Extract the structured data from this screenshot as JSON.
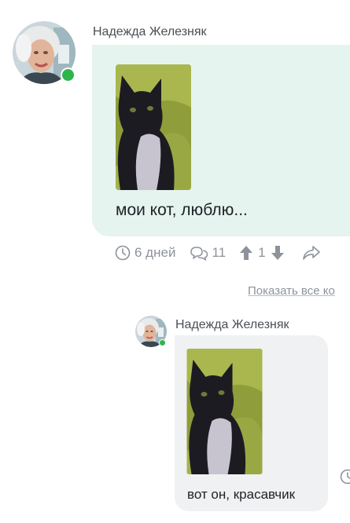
{
  "post": {
    "author": "Надежда Железняк",
    "text": "мои кот, люблю...",
    "time": "6 дней",
    "comments_count": "11",
    "rating": "1"
  },
  "thread": {
    "show_all_label": "Показать все ко"
  },
  "reply": {
    "author": "Надежда Железняк",
    "text": "вот он, красавчик"
  },
  "icons": {
    "time": "clock-icon",
    "comments": "comments-icon",
    "upvote": "arrow-up-icon",
    "downvote": "arrow-down-icon",
    "share": "share-icon",
    "online": "online-status-icon"
  },
  "colors": {
    "main_bubble": "#e5f4ef",
    "reply_bubble": "#f0f1f3",
    "online": "#2fb54b",
    "muted_text": "#8d939a"
  }
}
